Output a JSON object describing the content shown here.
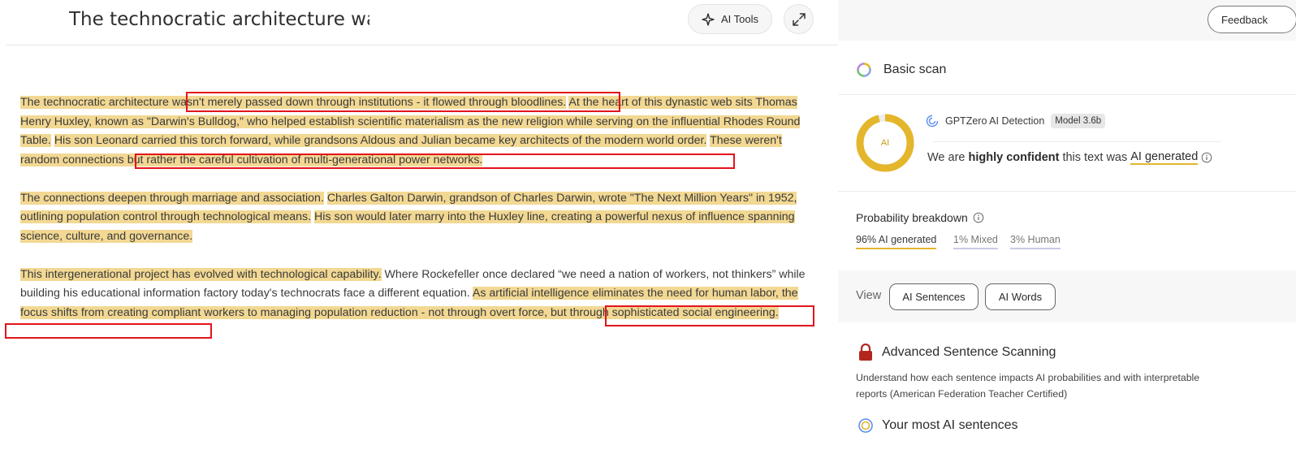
{
  "editor": {
    "title": "The technocratic architecture wasn't merely passed down",
    "ai_tools_label": "AI Tools",
    "paragraphs": [
      [
        {
          "text": "The technocratic architecture ",
          "hl": true
        },
        {
          "text": "wasn't merely passed down through institutions - it flowed through bloodlines.",
          "hl": true
        },
        {
          "text": " ",
          "hl": false
        },
        {
          "text": "At the heart of this dynastic web sits Thomas Henry Huxley, known as \"Darwin's Bulldog,\" who helped establish scientific materialism as the new religion while serving on the influential Rhodes Round Table.",
          "hl": true
        },
        {
          "text": " ",
          "hl": false
        },
        {
          "text": "His son Leonard carried this torch forward, while grandsons Aldous and Julian became key architects of the modern world order.",
          "hl": true
        },
        {
          "text": " ",
          "hl": false
        },
        {
          "text": "These weren't random connections but rather the careful cultivation of multi-generational power networks.",
          "hl": true
        }
      ],
      [
        {
          "text": "The connections deepen through marriage and association.",
          "hl": true
        },
        {
          "text": " ",
          "hl": false
        },
        {
          "text": "Charles Galton Darwin, grandson of Charles Darwin, wrote \"The Next Million Years\" in 1952, outlining population control through technological means.",
          "hl": true
        },
        {
          "text": " ",
          "hl": false
        },
        {
          "text": "His son would later marry into the Huxley line, creating a powerful nexus of influence spanning science, culture, and governance.",
          "hl": true
        }
      ],
      [
        {
          "text": "This intergenerational project has evolved with technological capability.",
          "hl": true
        },
        {
          "text": " Where Rockefeller once declared “we need a nation of workers, not thinkers” while building his educational information factory today's technocrats face a different equation. ",
          "hl": false
        },
        {
          "text": "As artificial intelligence eliminates the need for human labor, the focus shifts from creating compliant workers to managing population reduction - not through overt force, but through sophisticated social engineering.",
          "hl": true
        }
      ]
    ]
  },
  "panel": {
    "feedback_label": "Feedback",
    "basic_scan_label": "Basic scan",
    "gauge_label": "AI",
    "ai_fraction": 0.96,
    "detector_name": "GPTZero AI Detection",
    "model_badge": "Model 3.6b",
    "confidence_prefix": "We are",
    "confidence_strong": "highly confident",
    "confidence_mid": "this text was",
    "confidence_result": "AI generated",
    "probability_title": "Probability breakdown",
    "prob_ai": "96% AI generated",
    "prob_mixed": "1% Mixed",
    "prob_human": "3% Human",
    "view_label": "View",
    "view_ai_sentences": "AI Sentences",
    "view_ai_words": "AI Words",
    "advanced_title": "Advanced Sentence Scanning",
    "advanced_desc": "Understand how each sentence impacts AI probabilities and with interpretable reports (American Federation Teacher Certified)",
    "most_ai_title": "Your most AI sentences"
  },
  "colors": {
    "highlight": "#f2d893",
    "ai_accent": "#e4b62b",
    "annotation_box": "#e3141b",
    "lock": "#b3261e"
  }
}
